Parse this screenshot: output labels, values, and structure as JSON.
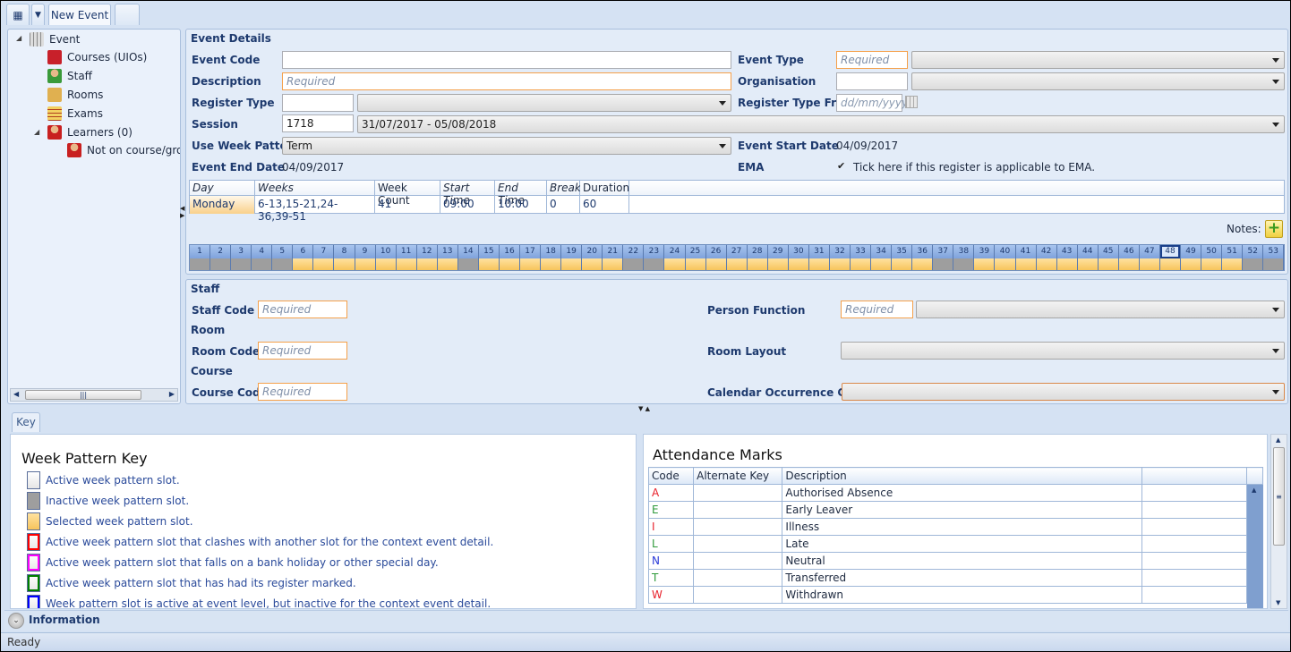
{
  "tabs": {
    "active": "New Event"
  },
  "tree": {
    "root": "Event",
    "items": [
      {
        "label": "Courses (UIOs)",
        "icon": "courses-icon"
      },
      {
        "label": "Staff",
        "icon": "staff-icon"
      },
      {
        "label": "Rooms",
        "icon": "rooms-icon"
      },
      {
        "label": "Exams",
        "icon": "exams-icon"
      },
      {
        "label": "Learners (0)",
        "icon": "learners-icon"
      },
      {
        "label": "Not on course/grou",
        "icon": "learner-icon"
      }
    ]
  },
  "event": {
    "title": "Event Details",
    "event_code_label": "Event Code",
    "event_code": "",
    "description_label": "Description",
    "description_placeholder": "Required",
    "register_type_label": "Register Type",
    "register_type": "",
    "session_label": "Session",
    "session_code": "1718",
    "session_range": "31/07/2017 - 05/08/2018",
    "week_pattern_label": "Use Week Pattern",
    "week_pattern": "Term",
    "end_date_label": "Event End Date",
    "end_date": "04/09/2017",
    "event_type_label": "Event Type",
    "event_type_placeholder": "Required",
    "organisation_label": "Organisation",
    "register_from_label": "Register Type From",
    "register_from_placeholder": "dd/mm/yyyy",
    "start_date_label": "Event Start Date",
    "start_date": "04/09/2017",
    "ema_label": "EMA",
    "ema_text": "Tick here if this register is applicable to EMA.",
    "ema_checked": true
  },
  "schedule": {
    "headers": [
      "Day",
      "Weeks",
      "Week Count",
      "Start Time",
      "End Time",
      "Break",
      "Duration"
    ],
    "row": [
      "Monday",
      "6-13,15-21,24-36,39-51",
      "41",
      "09:00",
      "10:00",
      "0",
      "60"
    ]
  },
  "notes_label": "Notes:",
  "weeks": {
    "count": 53,
    "inactive": [
      1,
      2,
      3,
      4,
      5,
      14,
      22,
      23,
      37,
      38,
      52,
      53
    ],
    "current": 48
  },
  "staff": {
    "title": "Staff",
    "staff_code_label": "Staff Code",
    "person_function_label": "Person Function",
    "placeholder": "Required",
    "room_title": "Room",
    "room_code_label": "Room Code",
    "room_layout_label": "Room Layout",
    "course_title": "Course",
    "course_code_label": "Course Code",
    "calendar_label": "Calendar Occurrence Code"
  },
  "key_tab": "Key",
  "key": {
    "title": "Week Pattern Key",
    "items": [
      {
        "text": "Active week pattern slot.",
        "color": "#ffffff"
      },
      {
        "text": "Inactive week pattern slot.",
        "color": "#9e9e9e"
      },
      {
        "text": "Selected week pattern slot.",
        "color": "#f7c45c"
      },
      {
        "text": "Active week pattern slot that clashes with another slot for the context event detail.",
        "color": "#ff0000"
      },
      {
        "text": "Active week pattern slot that falls on a bank holiday or other special day.",
        "color": "#ff00ff"
      },
      {
        "text": "Active week pattern slot that has had its register marked.",
        "color": "#008000"
      },
      {
        "text": "Week pattern slot is active at event level, but inactive for the context event detail.",
        "color": "#0000ff"
      }
    ]
  },
  "attendance": {
    "title": "Attendance Marks",
    "headers": [
      "Code",
      "Alternate Key",
      "Description",
      ""
    ],
    "rows": [
      {
        "code": "A",
        "desc": "Authorised Absence",
        "color": "#e8202a"
      },
      {
        "code": "E",
        "desc": "Early Leaver",
        "color": "#2e9a3a"
      },
      {
        "code": "I",
        "desc": "Illness",
        "color": "#e8202a"
      },
      {
        "code": "L",
        "desc": "Late",
        "color": "#2e9a3a"
      },
      {
        "code": "N",
        "desc": "Neutral",
        "color": "#2a3ad8"
      },
      {
        "code": "T",
        "desc": "Transferred",
        "color": "#2e9a3a"
      },
      {
        "code": "W",
        "desc": "Withdrawn",
        "color": "#e8202a"
      }
    ]
  },
  "information": "Information",
  "status": "Ready"
}
